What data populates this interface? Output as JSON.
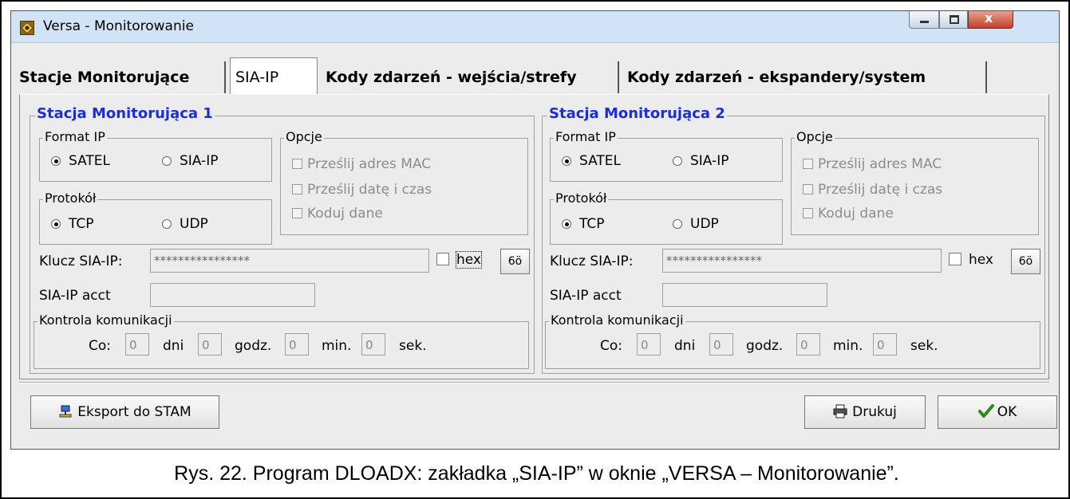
{
  "window": {
    "title": "Versa - Monitorowanie",
    "controls": {
      "minimize": "minimize",
      "maximize": "maximize",
      "close": "x"
    }
  },
  "tabs": [
    {
      "label": "Stacje Monitorujące",
      "active": false
    },
    {
      "label": "SIA-IP",
      "active": true
    },
    {
      "label": "Kody zdarzeń - wejścia/strefy",
      "active": false
    },
    {
      "label": "Kody zdarzeń - ekspandery/system",
      "active": false
    }
  ],
  "stations": [
    {
      "title": "Stacja Monitorująca 1",
      "format_ip": {
        "label": "Format IP",
        "options": [
          "SATEL",
          "SIA-IP"
        ],
        "selected": "SATEL"
      },
      "protokol": {
        "label": "Protokół",
        "options": [
          "TCP",
          "UDP"
        ],
        "selected": "TCP"
      },
      "opcje": {
        "label": "Opcje",
        "items": [
          "Prześlij adres MAC",
          "Prześlij datę i czas",
          "Koduj dane"
        ]
      },
      "klucz": {
        "label": "Klucz SIA-IP:",
        "value": "****************",
        "hex_label": "hex"
      },
      "acct": {
        "label": "SIA-IP acct",
        "value": ""
      },
      "kontrola": {
        "label": "Kontrola komunikacji",
        "co_label": "Co:",
        "dni_value": "0",
        "dni_label": "dni",
        "godz_value": "0",
        "godz_label": "godz.",
        "min_value": "0",
        "min_label": "min.",
        "sek_value": "0",
        "sek_label": "sek."
      }
    },
    {
      "title": "Stacja Monitorująca 2",
      "format_ip": {
        "label": "Format IP",
        "options": [
          "SATEL",
          "SIA-IP"
        ],
        "selected": "SATEL"
      },
      "protokol": {
        "label": "Protokół",
        "options": [
          "TCP",
          "UDP"
        ],
        "selected": "TCP"
      },
      "opcje": {
        "label": "Opcje",
        "items": [
          "Prześlij adres MAC",
          "Prześlij datę i czas",
          "Koduj dane"
        ]
      },
      "klucz": {
        "label": "Klucz SIA-IP:",
        "value": "****************",
        "hex_label": "hex"
      },
      "acct": {
        "label": "SIA-IP acct",
        "value": ""
      },
      "kontrola": {
        "label": "Kontrola komunikacji",
        "co_label": "Co:",
        "dni_value": "0",
        "dni_label": "dni",
        "godz_value": "0",
        "godz_label": "godz.",
        "min_value": "0",
        "min_label": "min.",
        "sek_value": "0",
        "sek_label": "sek."
      }
    }
  ],
  "buttons": {
    "eye_glyph": "6ö",
    "export": "Eksport do STAM",
    "print": "Drukuj",
    "ok": "OK"
  },
  "icons": {
    "eye": "view-password-icon",
    "export": "export-network-icon",
    "print": "printer-icon",
    "ok": "checkmark-icon",
    "app": "app-icon"
  },
  "colors": {
    "station_title": "#1c2ed6",
    "titlebar": "#d1e3f4",
    "close_button": "#c2402a",
    "ok_check": "#2e8b1f"
  },
  "caption": "Rys. 22. Program DLOADX: zakładka „SIA-IP” w oknie „VERSA – Monitorowanie”."
}
